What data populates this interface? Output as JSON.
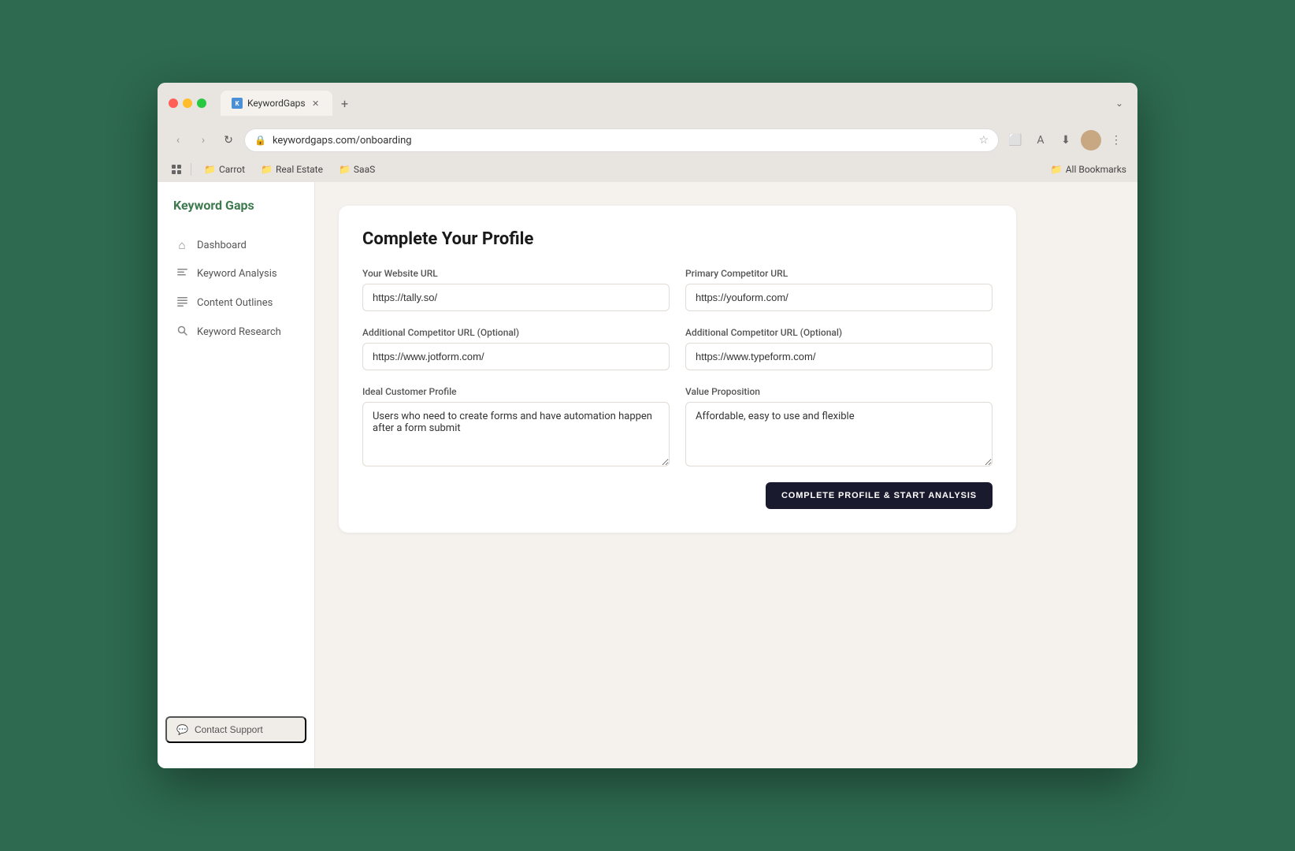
{
  "browser": {
    "tab_title": "KeywordGaps",
    "tab_favicon": "K",
    "url": "keywordgaps.com/onboarding",
    "bookmarks": [
      {
        "id": "carrot",
        "label": "Carrot"
      },
      {
        "id": "real-estate",
        "label": "Real Estate"
      },
      {
        "id": "saas",
        "label": "SaaS"
      }
    ],
    "all_bookmarks_label": "All Bookmarks"
  },
  "sidebar": {
    "logo": "Keyword Gaps",
    "nav_items": [
      {
        "id": "dashboard",
        "label": "Dashboard",
        "icon": "⌂"
      },
      {
        "id": "keyword-analysis",
        "label": "Keyword Analysis",
        "icon": "☰"
      },
      {
        "id": "content-outlines",
        "label": "Content Outlines",
        "icon": "≡"
      },
      {
        "id": "keyword-research",
        "label": "Keyword Research",
        "icon": "🔍"
      }
    ],
    "contact_support_label": "Contact Support"
  },
  "form": {
    "title": "Complete Your Profile",
    "fields": {
      "website_url": {
        "label": "Your Website URL",
        "value": "https://tally.so/"
      },
      "primary_competitor": {
        "label": "Primary Competitor URL",
        "value": "https://youform.com/"
      },
      "additional_competitor_1": {
        "label": "Additional Competitor URL (Optional)",
        "value": "https://www.jotform.com/"
      },
      "additional_competitor_2": {
        "label": "Additional Competitor URL (Optional)",
        "value": "https://www.typeform.com/"
      },
      "ideal_customer": {
        "label": "Ideal Customer Profile",
        "value": "Users who need to create forms and have automation happen after a form submit"
      },
      "value_proposition": {
        "label": "Value Proposition",
        "value": "Affordable, easy to use and flexible"
      }
    },
    "submit_button": "COMPLETE PROFILE & START ANALYSIS"
  }
}
